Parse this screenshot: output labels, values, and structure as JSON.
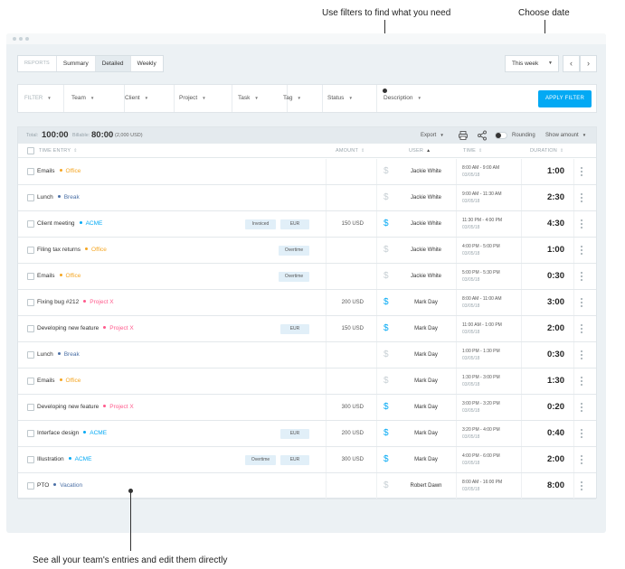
{
  "annotations": {
    "filters": "Use filters to find what you need",
    "date": "Choose date",
    "entries": "See all your team's entries and edit them directly"
  },
  "tabs": [
    {
      "label": "REPORTS",
      "style": "muted"
    },
    {
      "label": "Summary",
      "style": ""
    },
    {
      "label": "Detailed",
      "style": "active"
    },
    {
      "label": "Weekly",
      "style": ""
    }
  ],
  "date_range": {
    "selected": "This week",
    "prev_icon": "chevron-left-icon",
    "next_icon": "chevron-right-icon"
  },
  "filters": {
    "label": "FILTER",
    "items": [
      "Team",
      "Client",
      "Project",
      "Task",
      "Tag",
      "Status",
      "Description"
    ],
    "apply_label": "APPLY FILTER"
  },
  "summary": {
    "total_label": "Total:",
    "total_value": "100:00",
    "billable_label": "Billable:",
    "billable_value": "80:00",
    "amount": "(2,000 USD)",
    "export_label": "Export",
    "rounding_label": "Rounding",
    "show_amount_label": "Show amount"
  },
  "columns": {
    "entry": "TIME ENTRY",
    "amount": "AMOUNT",
    "user": "USER",
    "time": "TIME",
    "duration": "DURATION"
  },
  "colors": {
    "accent": "#03a9f4",
    "Office": "#f5a623",
    "Break": "#4a6fa5",
    "ACME": "#03a9f4",
    "Project X": "#ff5a8c",
    "Vacation": "#4a6fa5"
  },
  "entries": [
    {
      "desc": "Emails",
      "project": "Office",
      "tags": [],
      "amount": "",
      "billable": false,
      "user": "Jackie White",
      "time": "8:00 AM - 9:00 AM",
      "date": "03/05/18",
      "duration": "1:00"
    },
    {
      "desc": "Lunch",
      "project": "Break",
      "tags": [],
      "amount": "",
      "billable": false,
      "user": "Jackie White",
      "time": "9:00 AM - 11:30 AM",
      "date": "03/05/18",
      "duration": "2:30"
    },
    {
      "desc": "Client meeting",
      "project": "ACME",
      "tags": [
        "Invoiced",
        "EUR"
      ],
      "amount": "150 USD",
      "billable": true,
      "user": "Jackie White",
      "time": "11:30 PM - 4:00 PM",
      "date": "03/05/18",
      "duration": "4:30"
    },
    {
      "desc": "Filing tax returns",
      "project": "Office",
      "tags": [
        "Overtime"
      ],
      "amount": "",
      "billable": false,
      "user": "Jackie White",
      "time": "4:00 PM - 5:00 PM",
      "date": "03/05/18",
      "duration": "1:00"
    },
    {
      "desc": "Emails",
      "project": "Office",
      "tags": [
        "Overtime"
      ],
      "amount": "",
      "billable": false,
      "user": "Jackie White",
      "time": "5:00 PM - 5:30 PM",
      "date": "03/05/18",
      "duration": "0:30"
    },
    {
      "desc": "Fixing bug #212",
      "project": "Project X",
      "tags": [],
      "amount": "200 USD",
      "billable": true,
      "user": "Mark Day",
      "time": "8:00 AM - 11:00 AM",
      "date": "03/05/18",
      "duration": "3:00"
    },
    {
      "desc": "Developing new feature",
      "project": "Project X",
      "tags": [
        "EUR"
      ],
      "amount": "150 USD",
      "billable": true,
      "user": "Mark Day",
      "time": "11:00 AM - 1:00 PM",
      "date": "03/05/18",
      "duration": "2:00"
    },
    {
      "desc": "Lunch",
      "project": "Break",
      "tags": [],
      "amount": "",
      "billable": false,
      "user": "Mark Day",
      "time": "1:00 PM - 1:30 PM",
      "date": "03/05/18",
      "duration": "0:30"
    },
    {
      "desc": "Emails",
      "project": "Office",
      "tags": [],
      "amount": "",
      "billable": false,
      "user": "Mark Day",
      "time": "1:30 PM - 3:00 PM",
      "date": "03/05/18",
      "duration": "1:30"
    },
    {
      "desc": "Developing new feature",
      "project": "Project X",
      "tags": [],
      "amount": "300 USD",
      "billable": true,
      "user": "Mark Day",
      "time": "3:00 PM - 3:20 PM",
      "date": "03/05/18",
      "duration": "0:20"
    },
    {
      "desc": "Interface design",
      "project": "ACME",
      "tags": [
        "EUR"
      ],
      "amount": "200 USD",
      "billable": true,
      "user": "Mark Day",
      "time": "3:20 PM - 4:00 PM",
      "date": "03/05/18",
      "duration": "0:40"
    },
    {
      "desc": "Illustration",
      "project": "ACME",
      "tags": [
        "Overtime",
        "EUR"
      ],
      "amount": "300 USD",
      "billable": true,
      "user": "Mark Day",
      "time": "4:00 PM - 6:00 PM",
      "date": "03/05/18",
      "duration": "2:00"
    },
    {
      "desc": "PTO",
      "project": "Vacation",
      "tags": [],
      "amount": "",
      "billable": false,
      "user": "Robert Dawn",
      "time": "8:00 AM - 16:00 PM",
      "date": "03/05/18",
      "duration": "8:00"
    }
  ]
}
